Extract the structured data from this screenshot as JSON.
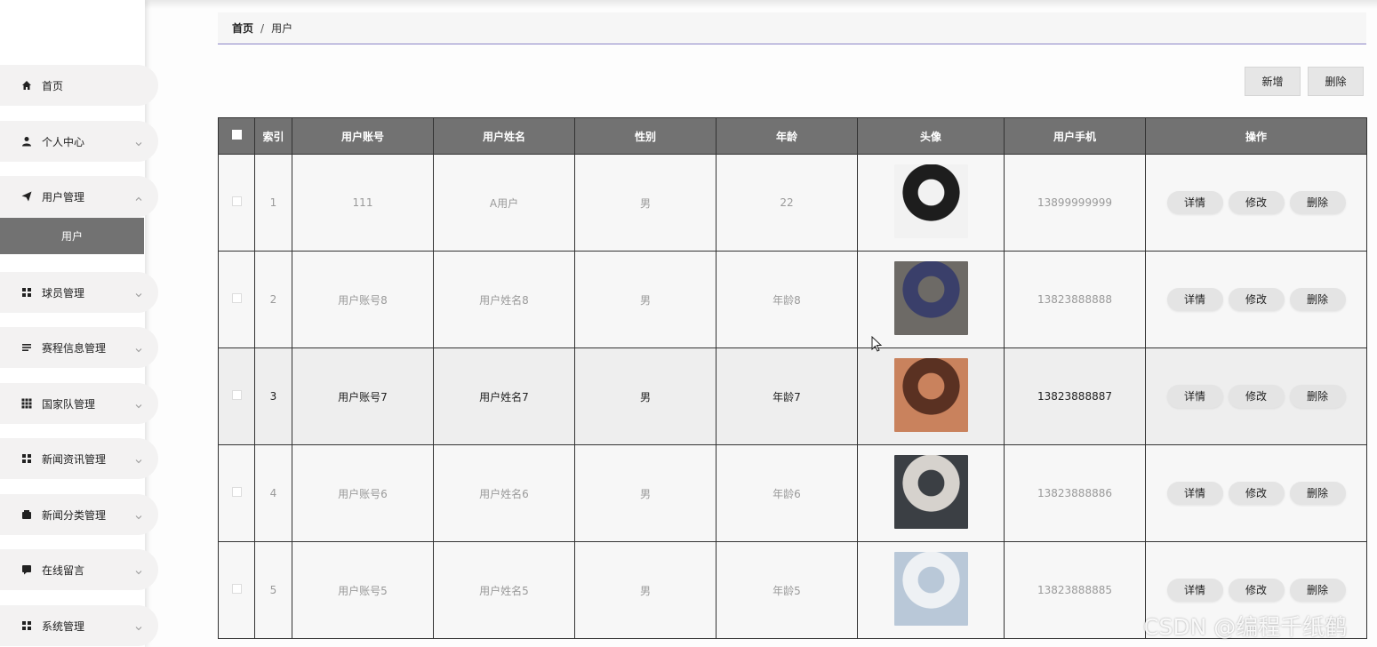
{
  "sidebar": {
    "items": [
      {
        "label": "首页",
        "icon": "home-icon",
        "expandable": false
      },
      {
        "label": "个人中心",
        "icon": "user-icon",
        "expandable": true
      },
      {
        "label": "用户管理",
        "icon": "send-icon",
        "expandable": true,
        "expanded": true
      },
      {
        "label": "球员管理",
        "icon": "grid-icon",
        "expandable": true
      },
      {
        "label": "赛程信息管理",
        "icon": "list-icon",
        "expandable": true
      },
      {
        "label": "国家队管理",
        "icon": "apps-icon",
        "expandable": true
      },
      {
        "label": "新闻资讯管理",
        "icon": "grid-icon",
        "expandable": true
      },
      {
        "label": "新闻分类管理",
        "icon": "wallet-icon",
        "expandable": true
      },
      {
        "label": "在线留言",
        "icon": "message-icon",
        "expandable": true
      },
      {
        "label": "系统管理",
        "icon": "grid-icon",
        "expandable": true
      }
    ],
    "sub_item": "用户"
  },
  "breadcrumb": {
    "home": "首页",
    "separator": "/",
    "current": "用户"
  },
  "toolbar": {
    "add_label": "新增",
    "delete_label": "删除"
  },
  "table": {
    "headers": [
      "索引",
      "用户账号",
      "用户姓名",
      "性别",
      "年龄",
      "头像",
      "用户手机",
      "操作"
    ],
    "actions": {
      "detail": "详情",
      "edit": "修改",
      "delete": "删除"
    },
    "rows": [
      {
        "index": "1",
        "account": "111",
        "name": "A用户",
        "gender": "男",
        "age": "22",
        "phone": "13899999999",
        "avatar_colors": [
          "#f2f2f2",
          "#1d1d1d"
        ]
      },
      {
        "index": "2",
        "account": "用户账号8",
        "name": "用户姓名8",
        "gender": "男",
        "age": "年龄8",
        "phone": "13823888888",
        "avatar_colors": [
          "#6d6a66",
          "#3a3f6a"
        ]
      },
      {
        "index": "3",
        "account": "用户账号7",
        "name": "用户姓名7",
        "gender": "男",
        "age": "年龄7",
        "phone": "13823888887",
        "avatar_colors": [
          "#c9825d",
          "#5a3122"
        ]
      },
      {
        "index": "4",
        "account": "用户账号6",
        "name": "用户姓名6",
        "gender": "男",
        "age": "年龄6",
        "phone": "13823888886",
        "avatar_colors": [
          "#3b3f44",
          "#d6d2cd"
        ]
      },
      {
        "index": "5",
        "account": "用户账号5",
        "name": "用户姓名5",
        "gender": "男",
        "age": "年龄5",
        "phone": "13823888885",
        "avatar_colors": [
          "#b9c8d8",
          "#eef1f4"
        ]
      }
    ],
    "highlighted_row": 2
  },
  "watermark": "CSDN @编程千纸鹤"
}
